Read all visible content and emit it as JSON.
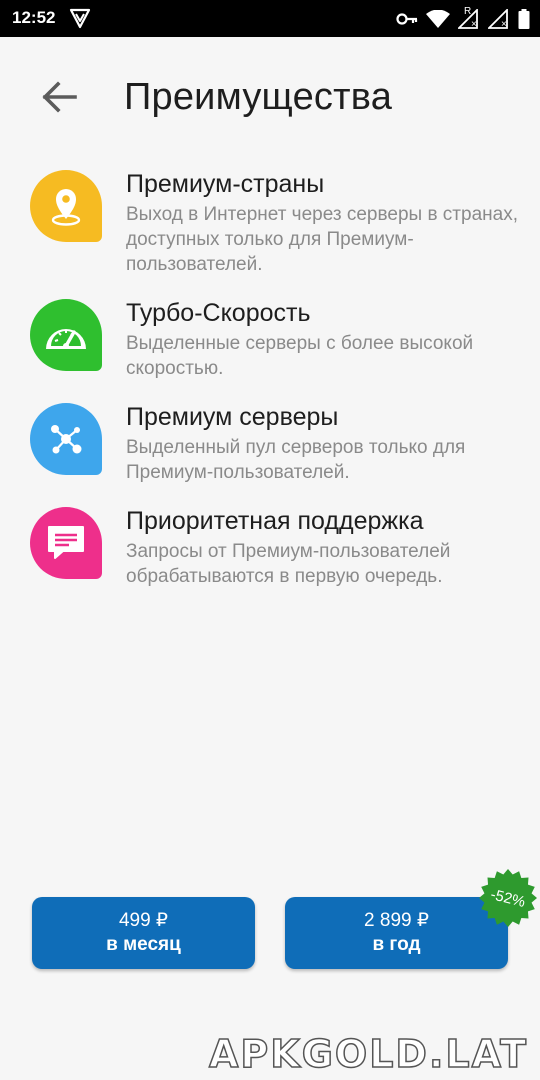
{
  "status_bar": {
    "time": "12:52",
    "icons": [
      "vpn-shield-icon",
      "key-icon",
      "wifi-icon",
      "signal-icon-r",
      "signal-icon",
      "battery-icon"
    ],
    "roaming_label": "R"
  },
  "header": {
    "back_icon": "arrow-left-icon",
    "title": "Преимущества"
  },
  "features": [
    {
      "icon": "location-pin-icon",
      "color": "#f6bb22",
      "title": "Премиум-страны",
      "description": "Выход в Интернет через серверы в странах, доступных только для Премиум-пользователей."
    },
    {
      "icon": "speedometer-icon",
      "color": "#2fbf2f",
      "title": "Турбо-Скорость",
      "description": "Выделенные серверы с более высокой скоростью."
    },
    {
      "icon": "network-nodes-icon",
      "color": "#3ea6ec",
      "title": "Премиум серверы",
      "description": "Выделенный пул серверов только для Премиум-пользователей."
    },
    {
      "icon": "chat-bubble-icon",
      "color": "#ee2f8b",
      "title": "Приоритетная поддержка",
      "description": "Запросы от Премиум-пользователей обрабатываются в первую очередь."
    }
  ],
  "plans": {
    "month": {
      "price": "499 ₽",
      "period": "в месяц"
    },
    "year": {
      "price": "2 899 ₽",
      "period": "в год",
      "discount": "-52%"
    }
  },
  "colors": {
    "button": "#0f6db8",
    "badge": "#2e9a2e"
  },
  "watermark": "APKGOLD.LAT"
}
